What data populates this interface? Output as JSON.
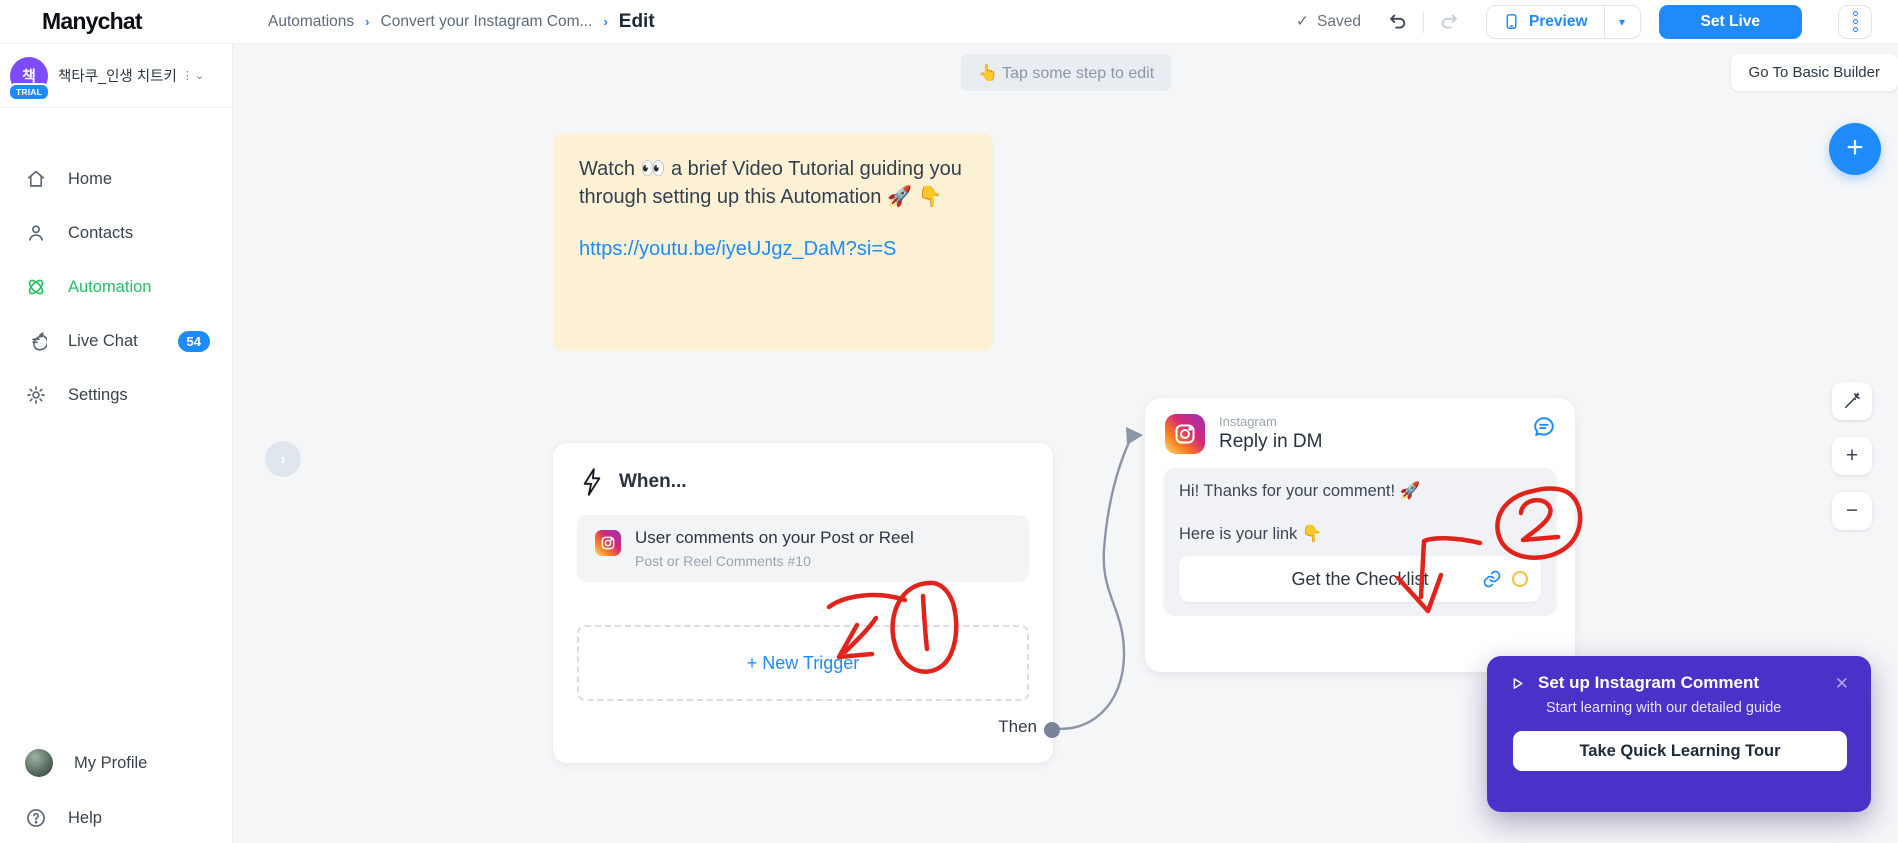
{
  "topbar": {
    "logo": "Manychat",
    "breadcrumbs": [
      "Automations",
      "Convert your Instagram Com..."
    ],
    "current_page": "Edit",
    "saved_check": "✓",
    "saved_label": "Saved",
    "preview_label": "Preview",
    "preview_chevron": "▾",
    "set_live_label": "Set Live"
  },
  "sidebar": {
    "avatar_letter": "책",
    "trial_badge": "TRIAL",
    "account_name": "책타쿠_인생 치트키",
    "account_chevron": "⌄",
    "items": [
      {
        "label": "Home"
      },
      {
        "label": "Contacts"
      },
      {
        "label": "Automation",
        "active": true
      },
      {
        "label": "Live Chat",
        "badge": "54"
      },
      {
        "label": "Settings"
      }
    ],
    "footer_items": [
      {
        "label": "My Profile"
      },
      {
        "label": "Help"
      }
    ]
  },
  "canvas": {
    "hint_label": "👆  Tap some step to edit",
    "go_to_basic_builder": "Go To Basic Builder",
    "chevron_right": "›",
    "note": {
      "text": "Watch 👀 a brief Video Tutorial guiding you through setting up this Automation 🚀 👇",
      "link": "https://youtu.be/iyeUJgz_DaM?si=S"
    },
    "when_card": {
      "title": "When...",
      "trigger_title": "User comments on your Post or Reel",
      "trigger_subtitle": "Post or Reel Comments #10",
      "new_trigger_label": "+ New Trigger",
      "then_label": "Then"
    },
    "reply_card": {
      "app": "Instagram",
      "title": "Reply in DM",
      "message_1": "Hi! Thanks for your comment! 🚀",
      "message_2": "Here is your link 👇",
      "button_label": "Get the Checklist"
    },
    "fab_plus": "+",
    "zoom_in": "+",
    "zoom_out": "−"
  },
  "popup": {
    "title": "Set up Instagram Comment",
    "subtitle": "Start learning with our detailed guide",
    "button_label": "Take Quick Learning Tour",
    "close": "✕"
  },
  "colors": {
    "accent_blue": "#1f8af9",
    "automation_green": "#27bd68",
    "popup_purple": "#4b31c8",
    "annotation_red": "#e0231b",
    "note_bg": "#fcf1d4",
    "avatar_purple": "#7c4dff"
  }
}
